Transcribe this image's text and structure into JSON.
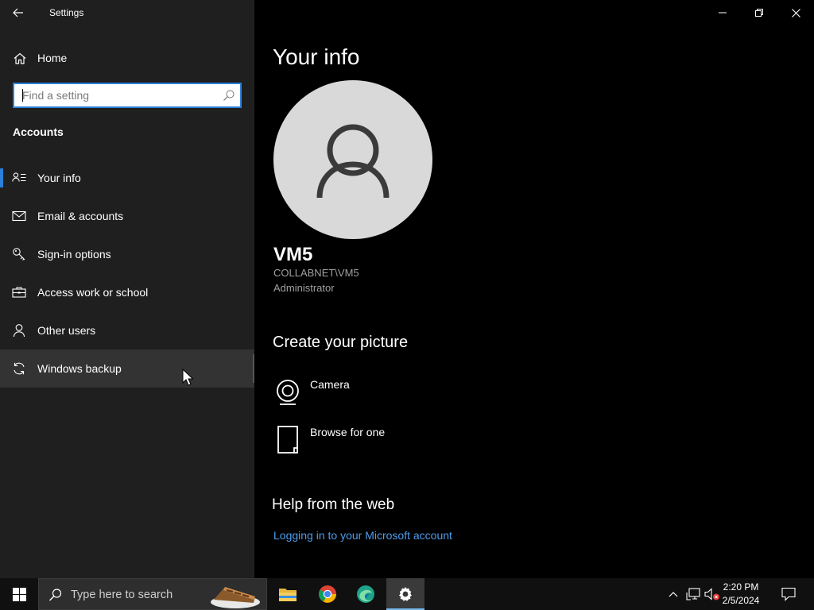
{
  "app": {
    "title": "Settings"
  },
  "sidebar": {
    "home_label": "Home",
    "search_placeholder": "Find a setting",
    "section_title": "Accounts",
    "items": [
      {
        "label": "Your info",
        "icon": "person-list-icon",
        "active": true
      },
      {
        "label": "Email & accounts",
        "icon": "mail-icon"
      },
      {
        "label": "Sign-in options",
        "icon": "key-icon"
      },
      {
        "label": "Access work or school",
        "icon": "briefcase-icon"
      },
      {
        "label": "Other users",
        "icon": "person-icon"
      },
      {
        "label": "Windows backup",
        "icon": "sync-icon",
        "hovered": true
      }
    ]
  },
  "main": {
    "page_title": "Your info",
    "user": {
      "name": "VM5",
      "account": "COLLABNET\\VM5",
      "role": "Administrator"
    },
    "create_picture": {
      "title": "Create your picture",
      "options": [
        {
          "label": "Camera",
          "icon": "camera-icon"
        },
        {
          "label": "Browse for one",
          "icon": "file-icon"
        }
      ]
    },
    "help": {
      "title": "Help from the web",
      "link": "Logging in to your Microsoft account"
    }
  },
  "taskbar": {
    "search_text": "Type here to search",
    "apps": [
      "file-explorer-icon",
      "chrome-icon",
      "edge-icon",
      "settings-icon"
    ],
    "clock_time": "2:20 PM",
    "clock_date": "2/5/2024"
  },
  "colors": {
    "accent": "#2b80d8",
    "link": "#4c9ded",
    "sidebar_bg": "#1f1f1f",
    "main_bg": "#000000"
  }
}
